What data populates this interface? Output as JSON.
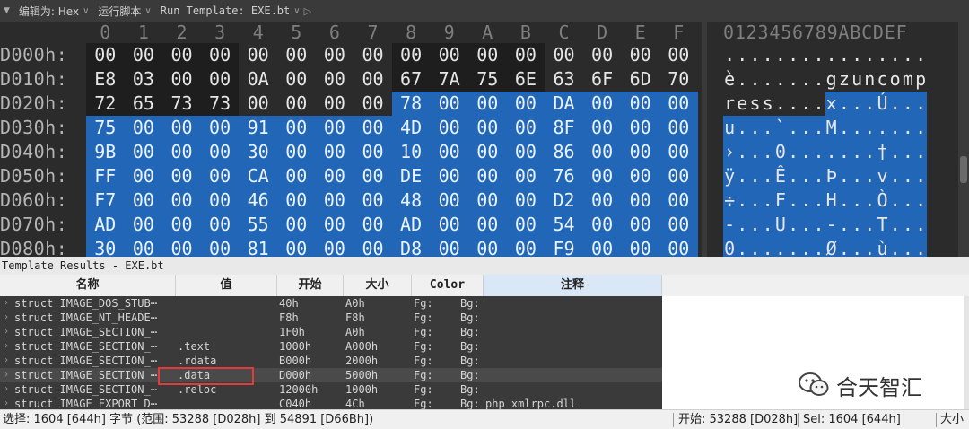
{
  "toolbar": {
    "menu_glyph": "▼",
    "edit_as": "编辑为: Hex",
    "run_script": "运行脚本",
    "run_template": "Run Template: EXE.bt",
    "play_glyph": "▷"
  },
  "hex": {
    "col_headers": [
      "0",
      "1",
      "2",
      "3",
      "4",
      "5",
      "6",
      "7",
      "8",
      "9",
      "A",
      "B",
      "C",
      "D",
      "E",
      "F"
    ],
    "ascii_header": "0123456789ABCDEF",
    "rows": [
      {
        "addr": "D000h:",
        "bytes": [
          "00",
          "00",
          "00",
          "00",
          "00",
          "00",
          "00",
          "00",
          "00",
          "00",
          "00",
          "00",
          "00",
          "00",
          "00",
          "00"
        ],
        "ascii": "................",
        "sel_from": 16
      },
      {
        "addr": "D010h:",
        "bytes": [
          "E8",
          "03",
          "00",
          "00",
          "0A",
          "00",
          "00",
          "00",
          "67",
          "7A",
          "75",
          "6E",
          "63",
          "6F",
          "6D",
          "70"
        ],
        "ascii": "è.......gzuncomp",
        "sel_from": 16
      },
      {
        "addr": "D020h:",
        "bytes": [
          "72",
          "65",
          "73",
          "73",
          "00",
          "00",
          "00",
          "00",
          "78",
          "00",
          "00",
          "00",
          "DA",
          "00",
          "00",
          "00"
        ],
        "ascii": "ress....x...Ú...",
        "sel_from": 8
      },
      {
        "addr": "D030h:",
        "bytes": [
          "75",
          "00",
          "00",
          "00",
          "91",
          "00",
          "00",
          "00",
          "4D",
          "00",
          "00",
          "00",
          "8F",
          "00",
          "00",
          "00"
        ],
        "ascii": "u...`...M.......",
        "sel_from": 0
      },
      {
        "addr": "D040h:",
        "bytes": [
          "9B",
          "00",
          "00",
          "00",
          "30",
          "00",
          "00",
          "00",
          "10",
          "00",
          "00",
          "00",
          "86",
          "00",
          "00",
          "00"
        ],
        "ascii": "›...0.......†...",
        "sel_from": 0
      },
      {
        "addr": "D050h:",
        "bytes": [
          "FF",
          "00",
          "00",
          "00",
          "CA",
          "00",
          "00",
          "00",
          "DE",
          "00",
          "00",
          "00",
          "76",
          "00",
          "00",
          "00"
        ],
        "ascii": "ÿ...Ê...Þ...v...",
        "sel_from": 0
      },
      {
        "addr": "D060h:",
        "bytes": [
          "F7",
          "00",
          "00",
          "00",
          "46",
          "00",
          "00",
          "00",
          "48",
          "00",
          "00",
          "00",
          "D2",
          "00",
          "00",
          "00"
        ],
        "ascii": "÷...F...H...Ò...",
        "sel_from": 0
      },
      {
        "addr": "D070h:",
        "bytes": [
          "AD",
          "00",
          "00",
          "00",
          "55",
          "00",
          "00",
          "00",
          "AD",
          "00",
          "00",
          "00",
          "54",
          "00",
          "00",
          "00"
        ],
        "ascii": "-...U...-...T...",
        "sel_from": 0
      },
      {
        "addr": "D080h:",
        "bytes": [
          "30",
          "00",
          "00",
          "00",
          "81",
          "00",
          "00",
          "00",
          "D8",
          "00",
          "00",
          "00",
          "F9",
          "00",
          "00",
          "00"
        ],
        "ascii": "0.......Ø...ù...",
        "sel_from": 0
      }
    ]
  },
  "template": {
    "title": "Template Results - EXE.bt",
    "columns": {
      "name": "名称",
      "value": "值",
      "start": "开始",
      "size": "大小",
      "color": "Color",
      "comment": "注释"
    },
    "rows": [
      {
        "name": "struct IMAGE_DOS_STUB⋯",
        "value": "",
        "start": "40h",
        "size": "A0h",
        "fg": "Fg:",
        "bg": "Bg:",
        "comment": ""
      },
      {
        "name": "struct IMAGE_NT_HEADE⋯",
        "value": "",
        "start": "F8h",
        "size": "F8h",
        "fg": "Fg:",
        "bg": "Bg:",
        "comment": ""
      },
      {
        "name": "struct IMAGE_SECTION_⋯",
        "value": "",
        "start": "1F0h",
        "size": "A0h",
        "fg": "Fg:",
        "bg": "Bg:",
        "comment": ""
      },
      {
        "name": "struct IMAGE_SECTION_⋯",
        "value": ".text",
        "start": "1000h",
        "size": "A000h",
        "fg": "Fg:",
        "bg": "Bg:",
        "comment": ""
      },
      {
        "name": "struct IMAGE_SECTION_⋯",
        "value": ".rdata",
        "start": "B000h",
        "size": "2000h",
        "fg": "Fg:",
        "bg": "Bg:",
        "comment": ""
      },
      {
        "name": "struct IMAGE_SECTION_⋯",
        "value": ".data",
        "start": "D000h",
        "size": "5000h",
        "fg": "Fg:",
        "bg": "Bg:",
        "comment": "",
        "highlight": true
      },
      {
        "name": "struct IMAGE_SECTION_⋯",
        "value": ".reloc",
        "start": "12000h",
        "size": "1000h",
        "fg": "Fg:",
        "bg": "Bg:",
        "comment": ""
      },
      {
        "name": "struct IMAGE_EXPORT_D⋯",
        "value": "",
        "start": "C040h",
        "size": "4Ch",
        "fg": "Fg:",
        "bg": "Bg:",
        "comment": "php_xmlrpc.dll"
      }
    ]
  },
  "watermark": {
    "text": "合天智汇"
  },
  "status": {
    "selection": "选择: 1604 [644h] 字节 (范围: 53288 [D028h] 到 54891 [D66Bh])",
    "start": "开始: 53288 [D028h]",
    "sel": "Sel: 1604 [644h]",
    "size": "大小"
  },
  "colors": {
    "selection": "#2267b7",
    "background": "#2b2b2b",
    "highlight_box": "#e23b3b"
  }
}
